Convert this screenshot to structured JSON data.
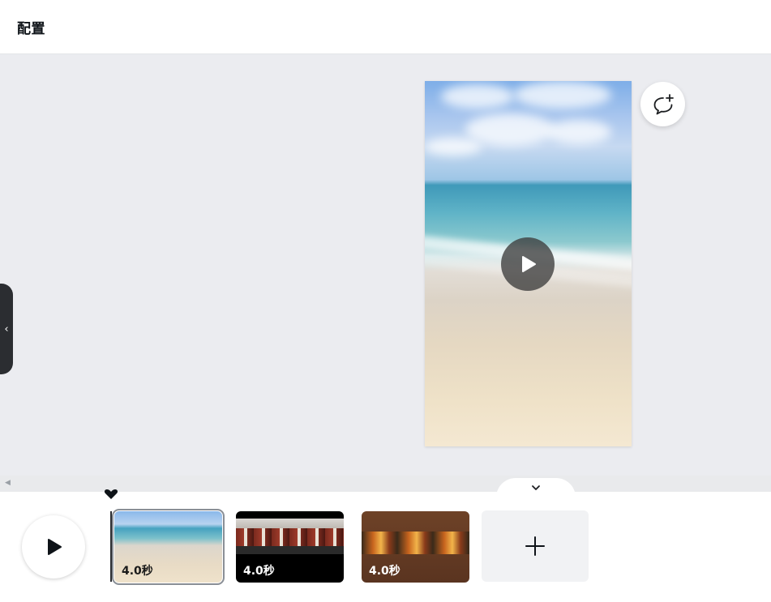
{
  "header": {
    "title": "配置"
  },
  "preview": {
    "play_icon": "play-icon",
    "comment_icon": "add-comment-icon"
  },
  "side_panel": {
    "toggle_icon": "chevron-left-icon"
  },
  "timeline": {
    "collapse_icon": "chevron-down-icon",
    "play_icon": "play-icon",
    "clips": [
      {
        "duration": "4.0秒",
        "thumbnail": "beach"
      },
      {
        "duration": "4.0秒",
        "thumbnail": "temple"
      },
      {
        "duration": "4.0秒",
        "thumbnail": "food"
      }
    ],
    "add_icon": "plus-icon"
  },
  "colors": {
    "canvas_bg": "#ebecf0",
    "dark": "#2b2d31",
    "accent_outline": "#8a8f96"
  }
}
